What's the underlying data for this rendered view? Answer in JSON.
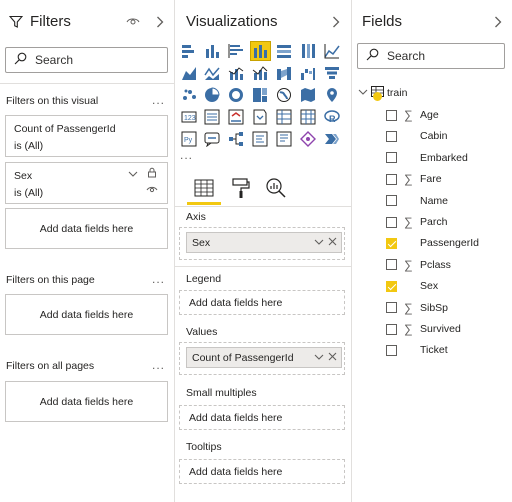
{
  "filters": {
    "title": "Filters",
    "search_placeholder": "Search",
    "on_visual_label": "Filters on this visual",
    "card1": {
      "title": "Count of PassengerId",
      "state": "is (All)"
    },
    "card2": {
      "title": "Sex",
      "state": "is (All)"
    },
    "add_fields": "Add data fields here",
    "on_page_label": "Filters on this page",
    "on_all_pages_label": "Filters on all pages",
    "ellipsis": "..."
  },
  "viz": {
    "title": "Visualizations",
    "ellipsis": "...",
    "axis_label": "Axis",
    "axis_value": "Sex",
    "legend_label": "Legend",
    "values_label": "Values",
    "values_value": "Count of PassengerId",
    "small_multiples_label": "Small multiples",
    "tooltips_label": "Tooltips",
    "add_fields": "Add data fields here",
    "active_tab": "fields",
    "accent_color": "#f2c811"
  },
  "fields": {
    "title": "Fields",
    "search_placeholder": "Search",
    "table_name": "train",
    "items": [
      {
        "name": "Age",
        "sigma": true,
        "checked": false
      },
      {
        "name": "Cabin",
        "sigma": false,
        "checked": false
      },
      {
        "name": "Embarked",
        "sigma": false,
        "checked": false
      },
      {
        "name": "Fare",
        "sigma": true,
        "checked": false
      },
      {
        "name": "Name",
        "sigma": false,
        "checked": false
      },
      {
        "name": "Parch",
        "sigma": true,
        "checked": false
      },
      {
        "name": "PassengerId",
        "sigma": false,
        "checked": true
      },
      {
        "name": "Pclass",
        "sigma": true,
        "checked": false
      },
      {
        "name": "Sex",
        "sigma": false,
        "checked": true
      },
      {
        "name": "SibSp",
        "sigma": true,
        "checked": false
      },
      {
        "name": "Survived",
        "sigma": true,
        "checked": false
      },
      {
        "name": "Ticket",
        "sigma": false,
        "checked": false
      }
    ]
  },
  "colors": {
    "accent": "#f2c811",
    "border": "#c8c6c4",
    "text": "#252423"
  }
}
